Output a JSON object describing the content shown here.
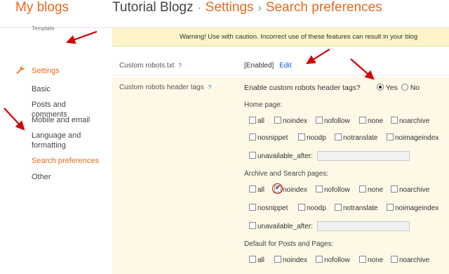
{
  "header": {
    "brand": "My blogs",
    "blog_name": "Tutorial Blogz",
    "sep1": "·",
    "settings": "Settings",
    "sep2": "›",
    "page": "Search preferences"
  },
  "sidebar": {
    "cut_item": "Template",
    "settings": "Settings",
    "items": [
      {
        "label": "Basic"
      },
      {
        "label": "Posts and comments"
      },
      {
        "label": "Mobile and email"
      },
      {
        "label": "Language and"
      },
      {
        "label": "formatting"
      },
      {
        "label": "Search preferences"
      },
      {
        "label": "Other"
      }
    ]
  },
  "warning": "Warning! Use with caution. Incorrect use of these features can result in your blog",
  "robots_txt": {
    "label": "Custom robots.txt",
    "help": "?",
    "status": "[Enabled]",
    "edit": "Edit"
  },
  "header_tags": {
    "label": "Custom robots header tags",
    "help": "?",
    "question": "Enable custom robots header tags?",
    "yes": "Yes",
    "no": "No",
    "enabled": true
  },
  "tag_labels": {
    "all": "all",
    "noindex": "noindex",
    "nofollow": "nofollow",
    "none": "none",
    "noarchive": "noarchive",
    "nosnippet": "nosnippet",
    "noodp": "noodp",
    "notranslate": "notranslate",
    "noimageindex": "noimageindex",
    "unavailable_after": "unavailable_after:"
  },
  "sections": {
    "home": "Home page:",
    "archive": "Archive and Search pages:",
    "posts": "Default for Posts and Pages:"
  },
  "checked": {
    "archive_noindex": true
  },
  "colors": {
    "accent": "#e8691f",
    "link": "#1155cc",
    "warning_bg": "#fcf3c9",
    "panel_bg": "#fdf9e6",
    "annotation_red": "#d40000"
  }
}
